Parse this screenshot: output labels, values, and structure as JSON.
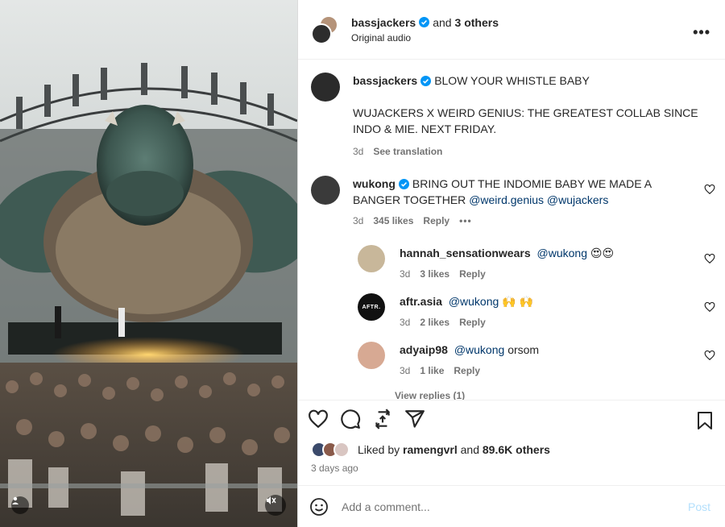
{
  "header": {
    "username": "bassjackers",
    "and_text": "and",
    "others": "3 others",
    "audio": "Original audio",
    "more_label": "•••"
  },
  "caption": {
    "username": "bassjackers",
    "line1": "BLOW YOUR WHISTLE BABY",
    "line2": "WUJACKERS X WEIRD GENIUS: THE GREATEST COLLAB SINCE INDO & MIE. NEXT FRIDAY.",
    "time": "3d",
    "translation": "See translation"
  },
  "comments": [
    {
      "username": "wukong",
      "verified": true,
      "text": "BRING OUT THE INDOMIE BABY WE MADE A BANGER TOGETHER",
      "mentions": [
        "@weird.genius",
        "@wujackers"
      ],
      "time": "3d",
      "likes": "345 likes",
      "reply": "Reply",
      "more": "•••",
      "avatar_color": "#3a3a3a"
    }
  ],
  "replies": [
    {
      "username": "hannah_sensationwears",
      "mention": "@wukong",
      "suffix": "😍😍",
      "time": "3d",
      "likes": "3 likes",
      "reply": "Reply",
      "avatar_color": "#c8b79a"
    },
    {
      "username": "aftr.asia",
      "mention": "@wukong",
      "suffix": "🙌 🙌",
      "time": "3d",
      "likes": "2 likes",
      "reply": "Reply",
      "avatar_text": "AFTR.",
      "avatar_color": "#111111"
    },
    {
      "username": "adyaip98",
      "mention": "@wukong",
      "suffix": "orsom",
      "time": "3d",
      "likes": "1 like",
      "reply": "Reply",
      "avatar_color": "#d7a993"
    }
  ],
  "view_replies": "View replies (1)",
  "likes": {
    "prefix": "Liked by",
    "user": "ramengvrl",
    "and_text": "and",
    "count": "89.6K others"
  },
  "date": "3 days ago",
  "add_comment": {
    "placeholder": "Add a comment...",
    "post_label": "Post"
  },
  "colors": {
    "verified": "#0095f6",
    "mention": "#00376b",
    "muted": "#737373",
    "post": "#b2dffc"
  },
  "icons": [
    "heart-icon",
    "comment-icon",
    "repost-icon",
    "share-icon",
    "bookmark-icon",
    "emoji-icon",
    "user-tag-icon",
    "mute-icon",
    "verified-icon",
    "more-icon"
  ]
}
